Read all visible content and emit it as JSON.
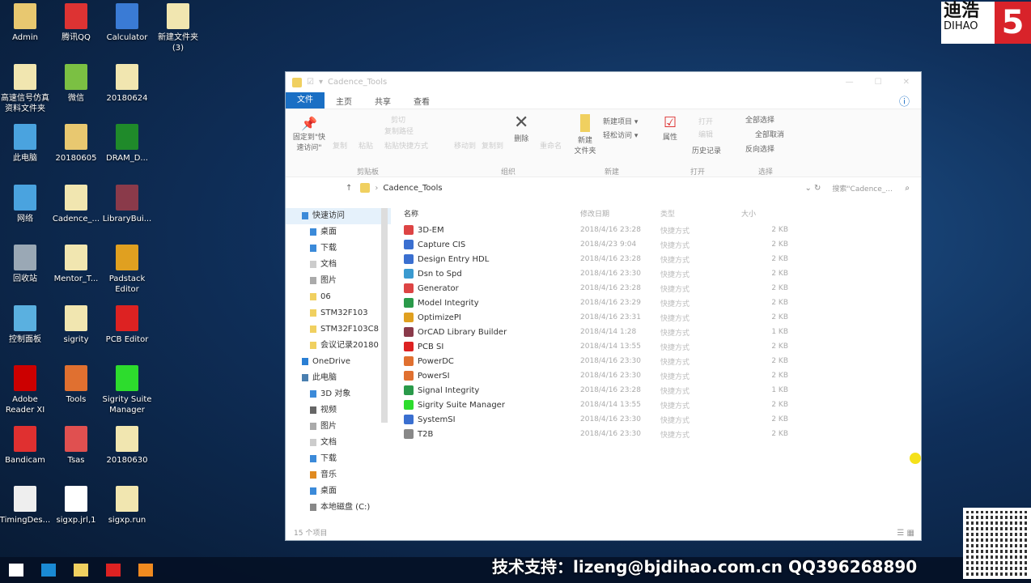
{
  "desktop_icons": [
    {
      "label": "Admin",
      "color": "#e8c870",
      "col": 0,
      "row": 0
    },
    {
      "label": "腾讯QQ",
      "color": "#d33",
      "col": 1,
      "row": 0
    },
    {
      "label": "Calculator",
      "color": "#3a7bd5",
      "col": 2,
      "row": 0
    },
    {
      "label": "新建文件夹\n(3)",
      "color": "#f1e6b0",
      "col": 3,
      "row": 0
    },
    {
      "label": "高速信号仿真\n资料文件夹",
      "color": "#f1e6b0",
      "col": 0,
      "row": 1
    },
    {
      "label": "微信",
      "color": "#7bc043",
      "col": 1,
      "row": 1
    },
    {
      "label": "20180624",
      "color": "#f1e6b0",
      "col": 2,
      "row": 1
    },
    {
      "label": "此电脑",
      "color": "#4aa3df",
      "col": 0,
      "row": 2
    },
    {
      "label": "20180605",
      "color": "#e8c870",
      "col": 1,
      "row": 2
    },
    {
      "label": "DRAM_D...",
      "color": "#1f8a2a",
      "col": 2,
      "row": 2
    },
    {
      "label": "网络",
      "color": "#4aa3df",
      "col": 0,
      "row": 3
    },
    {
      "label": "Cadence_...",
      "color": "#f1e6b0",
      "col": 1,
      "row": 3
    },
    {
      "label": "LibraryBui...",
      "color": "#8a3a4a",
      "col": 2,
      "row": 3
    },
    {
      "label": "回收站",
      "color": "#9aa8b5",
      "col": 0,
      "row": 4
    },
    {
      "label": "Mentor_T...",
      "color": "#f1e6b0",
      "col": 1,
      "row": 4
    },
    {
      "label": "Padstack\nEditor",
      "color": "#e0a020",
      "col": 2,
      "row": 4
    },
    {
      "label": "控制面板",
      "color": "#5ab0e0",
      "col": 0,
      "row": 5
    },
    {
      "label": "sigrity",
      "color": "#f1e6b0",
      "col": 1,
      "row": 5
    },
    {
      "label": "PCB Editor",
      "color": "#d22",
      "col": 2,
      "row": 5
    },
    {
      "label": "Adobe\nReader XI",
      "color": "#c00",
      "col": 0,
      "row": 6
    },
    {
      "label": "Tools",
      "color": "#e07030",
      "col": 1,
      "row": 6
    },
    {
      "label": "Sigrity Suite\nManager",
      "color": "#2ddc2d",
      "col": 2,
      "row": 6
    },
    {
      "label": "Bandicam",
      "color": "#e03030",
      "col": 0,
      "row": 7
    },
    {
      "label": "Tsas",
      "color": "#e05050",
      "col": 1,
      "row": 7
    },
    {
      "label": "20180630",
      "color": "#f1e6b0",
      "col": 2,
      "row": 7
    },
    {
      "label": "TimingDes...",
      "color": "#eee",
      "col": 0,
      "row": 8
    },
    {
      "label": "sigxp.jrl,1",
      "color": "#fff",
      "col": 1,
      "row": 8
    },
    {
      "label": "sigxp.run",
      "color": "#f1e6b0",
      "col": 2,
      "row": 8
    }
  ],
  "logo": {
    "cn": "迪浩",
    "en": "DIHAO",
    "mark": "5"
  },
  "explorer": {
    "title": "Cadence_Tools",
    "tabs": [
      "文件",
      "主页",
      "共享",
      "查看"
    ],
    "ribbon": {
      "pin": "固定到\"快速访问\"",
      "copy": "复制",
      "paste": "粘贴",
      "cut": "剪切",
      "copy_path": "复制路径",
      "paste_shortcut": "粘贴快捷方式",
      "move_to": "移动到",
      "copy_to": "复制到",
      "delete": "删除",
      "rename": "重命名",
      "new_folder": "新建\n文件夹",
      "new_item": "新建项目 ▾",
      "easy_access": "轻松访问 ▾",
      "properties": "属性",
      "open": "打开",
      "edit": "编辑",
      "history": "历史记录",
      "select_all": "全部选择",
      "select_none": "全部取消",
      "invert": "反向选择",
      "groups": [
        "剪贴板",
        "组织",
        "新建",
        "打开",
        "选择"
      ]
    },
    "address": "Cadence_Tools",
    "search_placeholder": "搜索\"Cadence_...",
    "nav": [
      {
        "label": "快速访问",
        "level": 0,
        "color": "#3b8ad9"
      },
      {
        "label": "桌面",
        "level": 1,
        "color": "#3b8ad9"
      },
      {
        "label": "下载",
        "level": 1,
        "color": "#3b8ad9"
      },
      {
        "label": "文档",
        "level": 1,
        "color": "#ccc"
      },
      {
        "label": "图片",
        "level": 1,
        "color": "#aaa"
      },
      {
        "label": "06",
        "level": 1,
        "color": "#f0d060"
      },
      {
        "label": "STM32F103",
        "level": 1,
        "color": "#f0d060"
      },
      {
        "label": "STM32F103C8",
        "level": 1,
        "color": "#f0d060"
      },
      {
        "label": "会议记录20180",
        "level": 1,
        "color": "#f0d060"
      },
      {
        "label": "OneDrive",
        "level": 0,
        "color": "#2a7fd4"
      },
      {
        "label": "此电脑",
        "level": 0,
        "color": "#4a7fb0"
      },
      {
        "label": "3D 对象",
        "level": 1,
        "color": "#3b8ad9"
      },
      {
        "label": "视频",
        "level": 1,
        "color": "#666"
      },
      {
        "label": "图片",
        "level": 1,
        "color": "#aaa"
      },
      {
        "label": "文档",
        "level": 1,
        "color": "#ccc"
      },
      {
        "label": "下载",
        "level": 1,
        "color": "#3b8ad9"
      },
      {
        "label": "音乐",
        "level": 1,
        "color": "#e08a20"
      },
      {
        "label": "桌面",
        "level": 1,
        "color": "#3b8ad9"
      },
      {
        "label": "本地磁盘 (C:)",
        "level": 1,
        "color": "#888"
      }
    ],
    "columns": [
      "名称",
      "修改日期",
      "类型",
      "大小"
    ],
    "files": [
      {
        "name": "3D-EM",
        "date": "2018/4/16 23:28",
        "type": "快捷方式",
        "size": "2 KB",
        "color": "#d44"
      },
      {
        "name": "Capture CIS",
        "date": "2018/4/23 9:04",
        "type": "快捷方式",
        "size": "2 KB",
        "color": "#3a6fd0"
      },
      {
        "name": "Design Entry HDL",
        "date": "2018/4/16 23:28",
        "type": "快捷方式",
        "size": "2 KB",
        "color": "#3a6fd0"
      },
      {
        "name": "Dsn to Spd",
        "date": "2018/4/16 23:30",
        "type": "快捷方式",
        "size": "2 KB",
        "color": "#3a9ad0"
      },
      {
        "name": "Generator",
        "date": "2018/4/16 23:28",
        "type": "快捷方式",
        "size": "2 KB",
        "color": "#d44"
      },
      {
        "name": "Model Integrity",
        "date": "2018/4/16 23:29",
        "type": "快捷方式",
        "size": "2 KB",
        "color": "#2a9a4a"
      },
      {
        "name": "OptimizePI",
        "date": "2018/4/16 23:31",
        "type": "快捷方式",
        "size": "2 KB",
        "color": "#e0a020"
      },
      {
        "name": "OrCAD Library Builder",
        "date": "2018/4/14 1:28",
        "type": "快捷方式",
        "size": "1 KB",
        "color": "#8a3a4a"
      },
      {
        "name": "PCB SI",
        "date": "2018/4/14 13:55",
        "type": "快捷方式",
        "size": "2 KB",
        "color": "#d22"
      },
      {
        "name": "PowerDC",
        "date": "2018/4/16 23:30",
        "type": "快捷方式",
        "size": "2 KB",
        "color": "#e07030"
      },
      {
        "name": "PowerSI",
        "date": "2018/4/16 23:30",
        "type": "快捷方式",
        "size": "2 KB",
        "color": "#e07030"
      },
      {
        "name": "Signal Integrity",
        "date": "2018/4/16 23:28",
        "type": "快捷方式",
        "size": "1 KB",
        "color": "#2a9a4a"
      },
      {
        "name": "Sigrity Suite Manager",
        "date": "2018/4/14 13:55",
        "type": "快捷方式",
        "size": "2 KB",
        "color": "#2ddc2d"
      },
      {
        "name": "SystemSI",
        "date": "2018/4/16 23:30",
        "type": "快捷方式",
        "size": "2 KB",
        "color": "#3a6fd0"
      },
      {
        "name": "T2B",
        "date": "2018/4/16 23:30",
        "type": "快捷方式",
        "size": "2 KB",
        "color": "#888"
      }
    ],
    "status": "15 个项目"
  },
  "watermark": "技术支持：lizeng@bjdihao.com.cn  QQ396268890",
  "taskbar": [
    {
      "name": "start",
      "color": "#fff"
    },
    {
      "name": "edge",
      "color": "#1a8ad4"
    },
    {
      "name": "file-explorer",
      "color": "#f0d060"
    },
    {
      "name": "pcb-editor",
      "color": "#d22"
    },
    {
      "name": "app",
      "color": "#f08a20"
    }
  ]
}
